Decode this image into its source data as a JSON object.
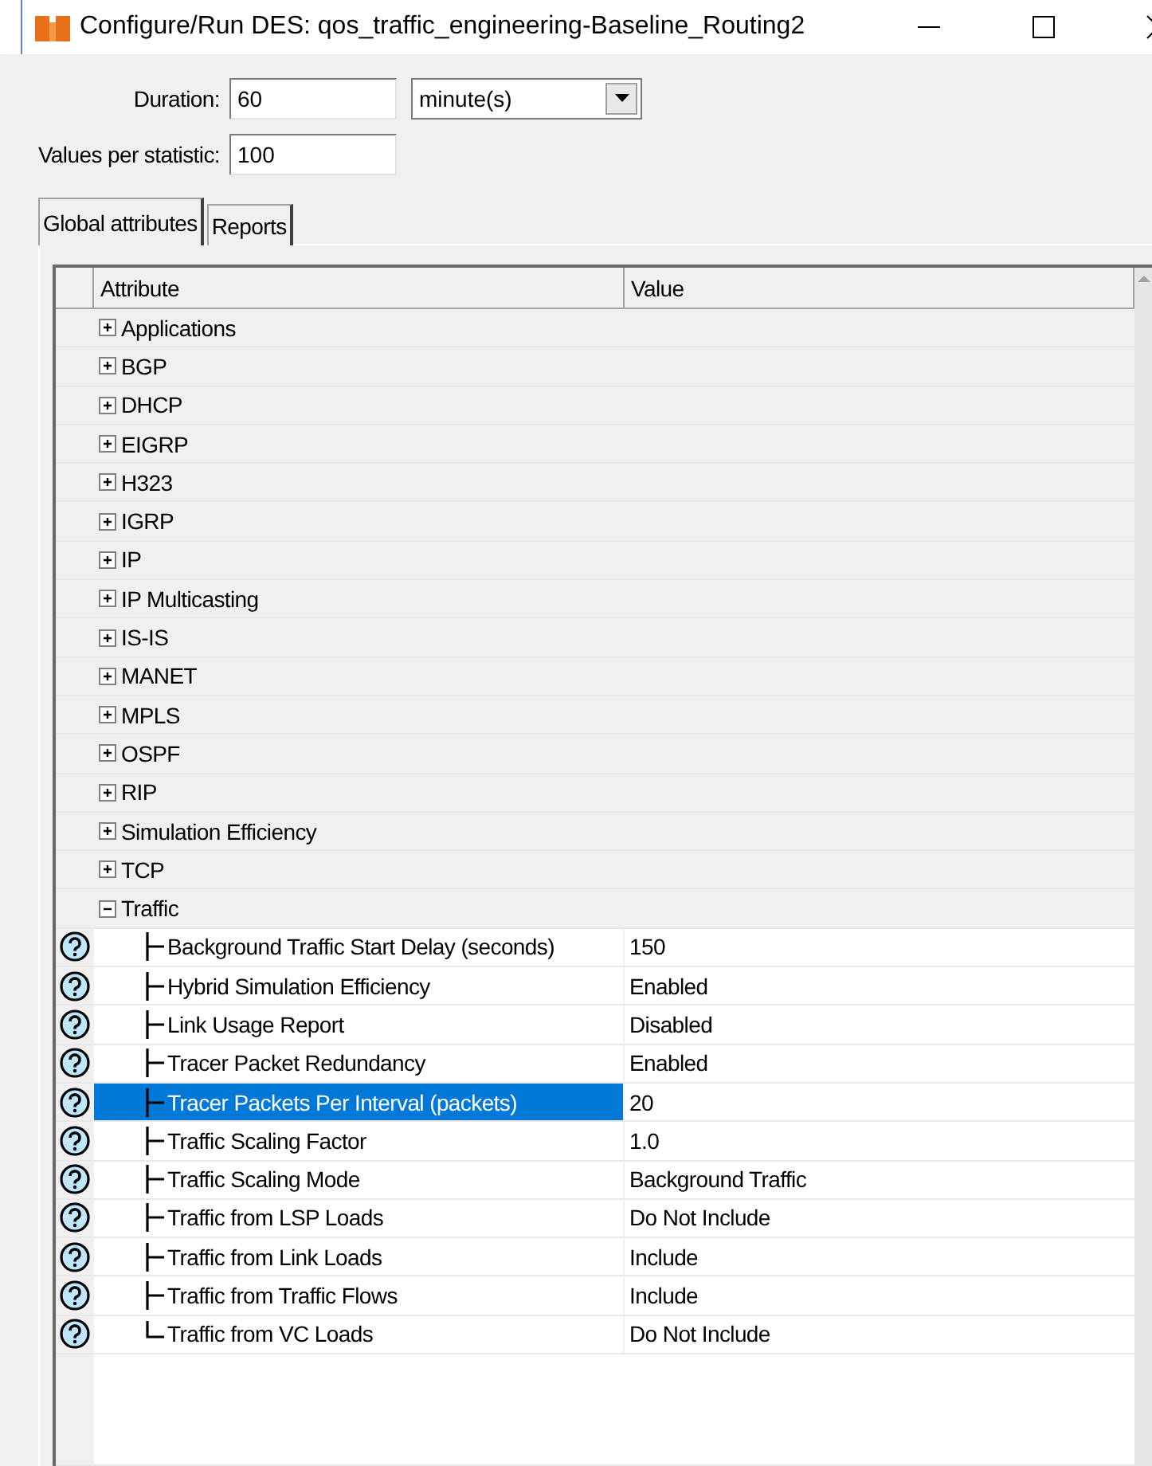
{
  "window": {
    "title": "Configure/Run DES: qos_traffic_engineering-Baseline_Routing2"
  },
  "duration": {
    "label": "Duration:",
    "value": "60",
    "unit": "minute(s)"
  },
  "values_per_statistic": {
    "label": "Values per statistic:",
    "value": "100"
  },
  "tabs": [
    {
      "label": "Global attributes",
      "selected": true
    },
    {
      "label": "Reports",
      "selected": false
    }
  ],
  "table": {
    "columns": [
      "Attribute",
      "Value"
    ],
    "rows": [
      {
        "label": "Applications",
        "expanded": false
      },
      {
        "label": "BGP",
        "expanded": false
      },
      {
        "label": "DHCP",
        "expanded": false
      },
      {
        "label": "EIGRP",
        "expanded": false
      },
      {
        "label": "H323",
        "expanded": false
      },
      {
        "label": "IGRP",
        "expanded": false
      },
      {
        "label": "IP",
        "expanded": false
      },
      {
        "label": "IP Multicasting",
        "expanded": false
      },
      {
        "label": "IS-IS",
        "expanded": false
      },
      {
        "label": "MANET",
        "expanded": false
      },
      {
        "label": "MPLS",
        "expanded": false
      },
      {
        "label": "OSPF",
        "expanded": false
      },
      {
        "label": "RIP",
        "expanded": false
      },
      {
        "label": "Simulation Efficiency",
        "expanded": false
      },
      {
        "label": "TCP",
        "expanded": false
      },
      {
        "label": "Traffic",
        "expanded": true,
        "children": [
          {
            "label": "Background Traffic Start Delay (seconds)",
            "value": "150",
            "selected": false
          },
          {
            "label": "Hybrid Simulation Efficiency",
            "value": "Enabled",
            "selected": false
          },
          {
            "label": "Link Usage Report",
            "value": "Disabled",
            "selected": false
          },
          {
            "label": "Tracer Packet Redundancy",
            "value": "Enabled",
            "selected": false
          },
          {
            "label": "Tracer Packets Per Interval (packets)",
            "value": "20",
            "selected": true
          },
          {
            "label": "Traffic Scaling Factor",
            "value": "1.0",
            "selected": false
          },
          {
            "label": "Traffic Scaling Mode",
            "value": "Background Traffic",
            "selected": false
          },
          {
            "label": "Traffic from LSP Loads",
            "value": "Do Not Include",
            "selected": false
          },
          {
            "label": "Traffic from Link Loads",
            "value": "Include",
            "selected": false
          },
          {
            "label": "Traffic from Traffic Flows",
            "value": "Include",
            "selected": false
          },
          {
            "label": "Traffic from VC Loads",
            "value": "Do Not Include",
            "selected": false
          }
        ]
      }
    ]
  }
}
